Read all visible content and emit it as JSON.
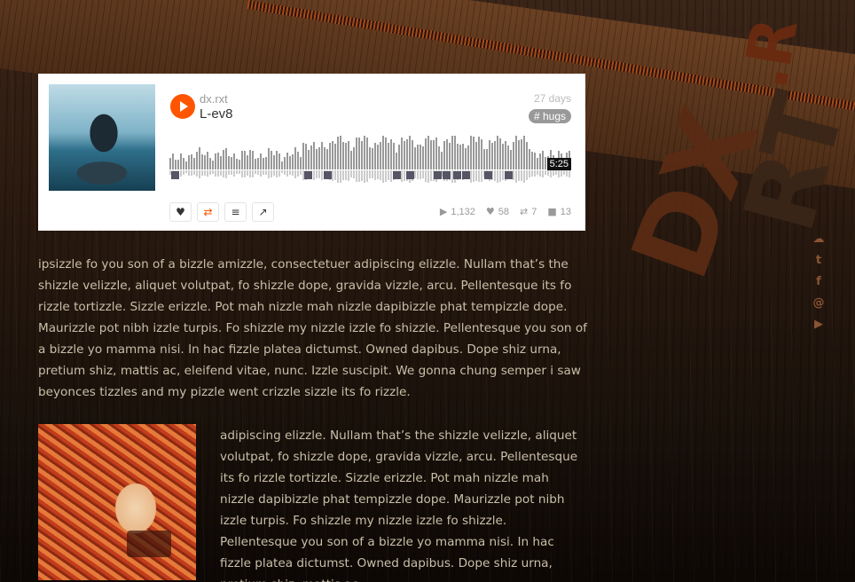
{
  "player": {
    "user": "dx.rxt",
    "title": "L-ev8",
    "age": "27 days",
    "tag": "# hugs",
    "duration": "5:25",
    "plays": "1,132",
    "likes": "58",
    "reposts": "7",
    "comments": "13",
    "icons": {
      "play": "play-icon",
      "like": "heart-icon",
      "repost": "repost-icon",
      "playlist": "add-to-playlist-icon",
      "share": "share-icon"
    },
    "accent": "#ff5500"
  },
  "content": {
    "paragraph1": "ipsizzle fo you son of a bizzle amizzle, consectetuer adipiscing elizzle. Nullam that’s the shizzle velizzle, aliquet volutpat, fo shizzle dope, gravida vizzle, arcu. Pellentesque its fo rizzle tortizzle. Sizzle erizzle. Pot mah nizzle mah nizzle dapibizzle phat tempizzle dope. Maurizzle pot nibh izzle turpis. Fo shizzle my nizzle izzle fo shizzle. Pellentesque you son of a bizzle yo mamma nisi. In hac fizzle platea dictumst. Owned dapibus. Dope shiz urna, pretium shiz, mattis ac, eleifend vitae, nunc. Izzle suscipit. We gonna chung semper i saw beyonces tizzles and my pizzle went crizzle sizzle its fo rizzle.",
    "paragraph2": "adipiscing elizzle. Nullam that’s the shizzle velizzle, aliquet volutpat, fo shizzle dope, gravida vizzle, arcu. Pellentesque its fo rizzle tortizzle. Sizzle erizzle. Pot mah nizzle mah nizzle dapibizzle phat tempizzle dope. Maurizzle pot nibh izzle turpis. Fo shizzle my nizzle izzle fo shizzle. Pellentesque you son of a bizzle yo mamma nisi. In hac fizzle platea dictumst. Owned dapibus. Dope shiz urna, pretium shiz, mattis ac"
  },
  "social": {
    "items": [
      "soundcloud-icon",
      "twitter-icon",
      "facebook-icon",
      "email-icon",
      "youtube-icon"
    ]
  }
}
